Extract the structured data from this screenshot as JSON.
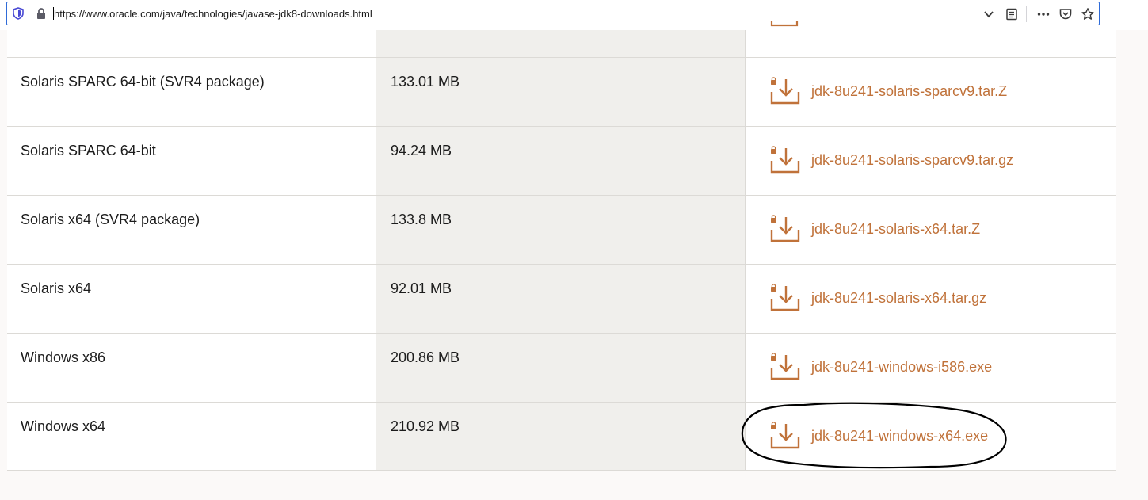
{
  "browser": {
    "url": "https://www.oracle.com/java/technologies/javase-jdk8-downloads.html"
  },
  "accent_color": "#c0723a",
  "downloads": [
    {
      "product": "Solaris SPARC 64-bit (SVR4 package)",
      "size": "133.01 MB",
      "file": "jdk-8u241-solaris-sparcv9.tar.Z"
    },
    {
      "product": "Solaris SPARC 64-bit",
      "size": "94.24 MB",
      "file": "jdk-8u241-solaris-sparcv9.tar.gz"
    },
    {
      "product": "Solaris x64 (SVR4 package)",
      "size": "133.8 MB",
      "file": "jdk-8u241-solaris-x64.tar.Z"
    },
    {
      "product": "Solaris x64",
      "size": "92.01 MB",
      "file": "jdk-8u241-solaris-x64.tar.gz"
    },
    {
      "product": "Windows x86",
      "size": "200.86 MB",
      "file": "jdk-8u241-windows-i586.exe"
    },
    {
      "product": "Windows x64",
      "size": "210.92 MB",
      "file": "jdk-8u241-windows-x64.exe"
    }
  ],
  "icons": {
    "shield": "tracking-protection-shield-icon",
    "lock": "padlock-icon",
    "dropdown": "chevron-down-icon",
    "reader": "reader-view-icon",
    "more": "more-actions-icon",
    "pocket": "pocket-icon",
    "bookmark": "star-icon",
    "download": "locked-download-icon"
  }
}
